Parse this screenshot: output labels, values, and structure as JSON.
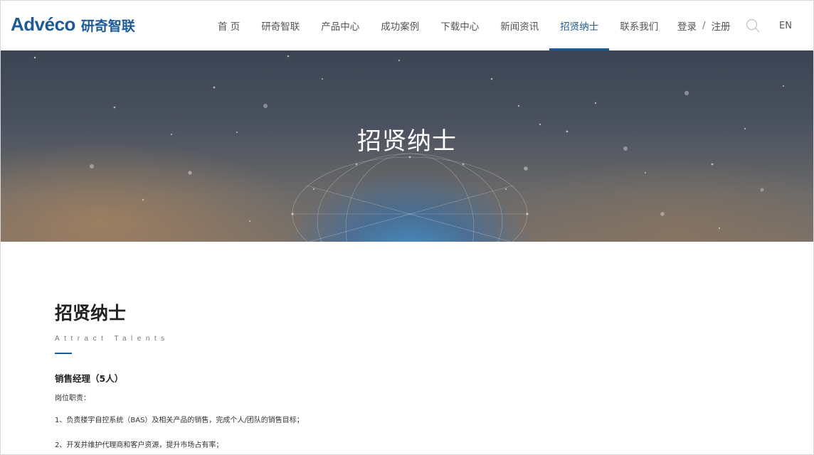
{
  "header": {
    "logo_en": "Advéco",
    "logo_cn": "研奇智联",
    "nav": [
      {
        "label": "首 页",
        "active": false
      },
      {
        "label": "研奇智联",
        "active": false
      },
      {
        "label": "产品中心",
        "active": false
      },
      {
        "label": "成功案例",
        "active": false
      },
      {
        "label": "下载中心",
        "active": false
      },
      {
        "label": "新闻资讯",
        "active": false
      },
      {
        "label": "招贤纳士",
        "active": true
      },
      {
        "label": "联系我们",
        "active": false
      }
    ],
    "login": "登录",
    "separator": "/",
    "register": "注册",
    "lang": "EN"
  },
  "banner": {
    "title": "招贤纳士"
  },
  "section": {
    "title": "招贤纳士",
    "subtitle": "Attract Talents"
  },
  "job": {
    "title": "销售经理（5人）",
    "duties_label": "岗位职责：",
    "duties": [
      "1、负责楼宇自控系统（BAS）及相关产品的销售，完成个人/团队的销售目标；",
      "2、开发并维护代理商和客户资源，提升市场占有率；"
    ]
  },
  "colors": {
    "brand": "#1d5a9a",
    "nav_text": "#555555"
  }
}
